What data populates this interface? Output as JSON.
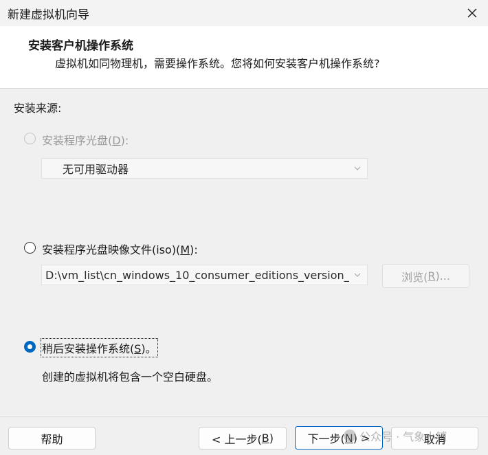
{
  "window": {
    "title": "新建虚拟机向导",
    "close_glyph": "close-icon"
  },
  "header": {
    "title": "安装客户机操作系统",
    "subtitle": "虚拟机如同物理机，需要操作系统。您将如何安装客户机操作系统?"
  },
  "install_source": {
    "label": "安装来源:",
    "options": [
      {
        "label_prefix": "安装程序光盘(",
        "accel": "D",
        "label_suffix": "):",
        "state": "disabled",
        "combo_value": "无可用驱动器"
      },
      {
        "label_prefix": "安装程序光盘映像文件(iso)(",
        "accel": "M",
        "label_suffix": "):",
        "state": "unchecked",
        "combo_value": "D:\\vm_list\\cn_windows_10_consumer_editions_version_",
        "browse_prefix": "浏览(",
        "browse_accel": "R",
        "browse_suffix": ")..."
      },
      {
        "label_prefix": "稍后安装操作系统(",
        "accel": "S",
        "label_suffix": ")。",
        "state": "checked",
        "description": "创建的虚拟机将包含一个空白硬盘。"
      }
    ]
  },
  "footer": {
    "help": "帮助",
    "back_prefix": "< 上一步(",
    "back_accel": "B",
    "back_suffix": ")",
    "next_prefix": "下一步(",
    "next_accel": "N",
    "next_suffix": ") >",
    "cancel": "取消"
  },
  "watermark": {
    "text": "公众号 · 气象小铺"
  },
  "colors": {
    "accent": "#0067c0",
    "disabled_text": "#9a9a9a"
  }
}
